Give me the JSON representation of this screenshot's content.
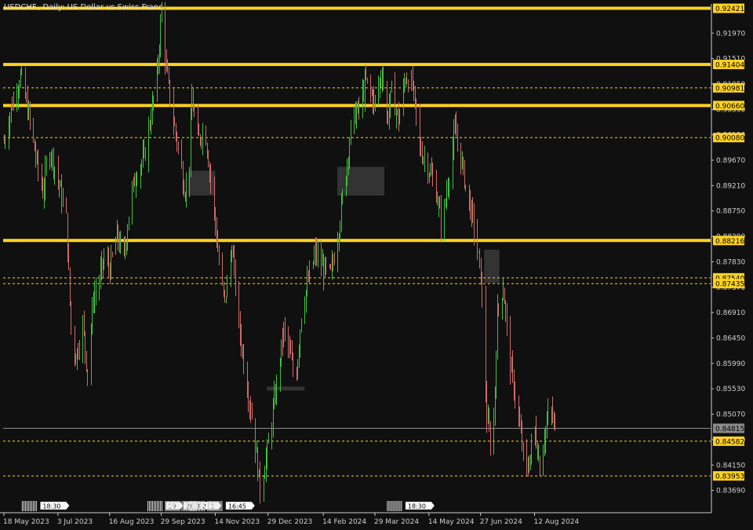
{
  "chart_data": {
    "type": "candlestick",
    "title": "USDCHF., Daily:  US Dollar vs Swiss Franc",
    "symbol": "USDCHF.",
    "timeframe": "Daily",
    "y_range": [
      0.834,
      0.925
    ],
    "y_ticks": [
      "0.91970",
      "0.91510",
      "0.91050",
      "0.90590",
      "0.90130",
      "0.89670",
      "0.89210",
      "0.88750",
      "0.88290",
      "0.87830",
      "0.87370",
      "0.86910",
      "0.86450",
      "0.85990",
      "0.85530",
      "0.85070",
      "0.84610",
      "0.84150",
      "0.83690"
    ],
    "x_labels": [
      "18 May 2023",
      "3 Jul 2023",
      "16 Aug 2023",
      "29 Sep 2023",
      "14 Nov 2023",
      "29 Dec 2023",
      "14 Feb 2024",
      "29 Mar 2024",
      "14 May 2024",
      "27 Jun 2024",
      "12 Aug 2024"
    ],
    "horizontal_levels": [
      {
        "price": "0.92421",
        "style": "solid",
        "color": "#ffd21f"
      },
      {
        "price": "0.91404",
        "style": "solid",
        "color": "#ffd21f"
      },
      {
        "price": "0.90981",
        "style": "dashed",
        "color": "#ffd21f"
      },
      {
        "price": "0.90660",
        "style": "solid",
        "color": "#ffd21f"
      },
      {
        "price": "0.90080",
        "style": "dashed",
        "color": "#ffd21f"
      },
      {
        "price": "0.88216",
        "style": "solid",
        "color": "#ffd21f"
      },
      {
        "price": "0.87540",
        "style": "dashed",
        "color": "#ffd21f"
      },
      {
        "price": "0.87435",
        "style": "dashed",
        "color": "#ffd21f"
      },
      {
        "price": "0.84582",
        "style": "dashed",
        "color": "#ffd21f"
      },
      {
        "price": "0.83953",
        "style": "dashed",
        "color": "#ffd21f"
      }
    ],
    "current_price": "0.84815",
    "path": [
      [
        "18 May 2023",
        0.9
      ],
      [
        "2023-05-25",
        0.907
      ],
      [
        "2023-06-01",
        0.912
      ],
      [
        "2023-06-08",
        0.905
      ],
      [
        "2023-06-15",
        0.896
      ],
      [
        "2023-06-20",
        0.891
      ],
      [
        "2023-06-26",
        0.899
      ],
      [
        "3 Jul 2023",
        0.893
      ],
      [
        "2023-07-10",
        0.886
      ],
      [
        "2023-07-14",
        0.866
      ],
      [
        "2023-07-18",
        0.861
      ],
      [
        "2023-07-24",
        0.867
      ],
      [
        "2023-07-28",
        0.858
      ],
      [
        "2023-08-02",
        0.872
      ],
      [
        "2023-08-07",
        0.875
      ],
      [
        "2023-08-11",
        0.879
      ],
      [
        "16 Aug 2023",
        0.877
      ],
      [
        "2023-08-22",
        0.883
      ],
      [
        "2023-08-28",
        0.879
      ],
      [
        "2023-09-02",
        0.889
      ],
      [
        "2023-09-08",
        0.895
      ],
      [
        "2023-09-14",
        0.897
      ],
      [
        "2023-09-20",
        0.905
      ],
      [
        "2023-09-25",
        0.912
      ],
      [
        "2023-09-29",
        0.924
      ],
      [
        "2023-10-03",
        0.913
      ],
      [
        "2023-10-08",
        0.905
      ],
      [
        "2023-10-13",
        0.899
      ],
      [
        "2023-10-18",
        0.892
      ],
      [
        "2023-10-22",
        0.891
      ],
      [
        "2023-10-25",
        0.908
      ],
      [
        "2023-10-30",
        0.9
      ],
      [
        "2023-11-05",
        0.903
      ],
      [
        "14 Nov 2023",
        0.885
      ],
      [
        "2023-11-18",
        0.876
      ],
      [
        "2023-11-22",
        0.871
      ],
      [
        "2023-11-28",
        0.881
      ],
      [
        "2023-12-04",
        0.867
      ],
      [
        "2023-12-10",
        0.857
      ],
      [
        "2023-12-16",
        0.849
      ],
      [
        "2023-12-22",
        0.837
      ],
      [
        "29 Dec 2023",
        0.845
      ],
      [
        "2024-01-05",
        0.856
      ],
      [
        "2024-01-11",
        0.866
      ],
      [
        "2024-01-17",
        0.861
      ],
      [
        "2024-01-21",
        0.856
      ],
      [
        "2024-01-26",
        0.869
      ],
      [
        "2024-02-01",
        0.875
      ],
      [
        "2024-02-07",
        0.88
      ],
      [
        "14 Feb 2024",
        0.877
      ],
      [
        "2024-02-20",
        0.876
      ],
      [
        "2024-02-26",
        0.883
      ],
      [
        "2024-03-03",
        0.893
      ],
      [
        "2024-03-09",
        0.904
      ],
      [
        "2024-03-15",
        0.906
      ],
      [
        "2024-03-21",
        0.911
      ],
      [
        "29 Mar 2024",
        0.907
      ],
      [
        "2024-04-04",
        0.913
      ],
      [
        "2024-04-08",
        0.904
      ],
      [
        "2024-04-12",
        0.909
      ],
      [
        "2024-04-18",
        0.904
      ],
      [
        "2024-04-24",
        0.912
      ],
      [
        "2024-04-30",
        0.91
      ],
      [
        "2024-05-06",
        0.899
      ],
      [
        "14 May 2024",
        0.895
      ],
      [
        "2024-05-20",
        0.891
      ],
      [
        "2024-05-25",
        0.884
      ],
      [
        "2024-05-30",
        0.893
      ],
      [
        "2024-06-05",
        0.902
      ],
      [
        "2024-06-10",
        0.897
      ],
      [
        "2024-06-15",
        0.891
      ],
      [
        "2024-06-20",
        0.886
      ],
      [
        "27 Jun 2024",
        0.876
      ],
      [
        "2024-07-02",
        0.85
      ],
      [
        "2024-07-07",
        0.843
      ],
      [
        "2024-07-11",
        0.869
      ],
      [
        "2024-07-16",
        0.874
      ],
      [
        "2024-07-21",
        0.861
      ],
      [
        "2024-07-27",
        0.853
      ],
      [
        "2024-08-01",
        0.845
      ],
      [
        "2024-08-05",
        0.84
      ],
      [
        "12 Aug 2024",
        0.848
      ],
      [
        "2024-08-16",
        0.841
      ],
      [
        "2024-08-20",
        0.847
      ],
      [
        "2024-08-25",
        0.852
      ],
      [
        "2024-08-29",
        0.848
      ]
    ],
    "zones": [
      {
        "from": "2023-10-22",
        "to": "2023-11-14",
        "price_top": 0.8948,
        "price_bottom": 0.8903
      },
      {
        "from": "2024-02-26",
        "to": "2024-04-06",
        "price_top": 0.8955,
        "price_bottom": 0.8903
      },
      {
        "from": "2024-06-30",
        "to": "2024-07-13",
        "price_top": 0.8805,
        "price_bottom": 0.8745
      },
      {
        "from": "2023-12-28",
        "to": "2024-01-29",
        "price_top": 0.8557,
        "price_bottom": 0.855
      }
    ],
    "session_markers": [
      {
        "date": "2023-06-20",
        "label": "18:30"
      },
      {
        "date": "2023-10-05",
        "label": "19"
      },
      {
        "date": "2023-10-20",
        "label": "20:3"
      },
      {
        "date": "2023-11-03",
        "label": "2"
      },
      {
        "date": "2023-11-10",
        "label": "1"
      },
      {
        "date": "2023-11-25",
        "label": "16:45"
      },
      {
        "date": "2024-04-26",
        "label": "18:30"
      }
    ],
    "colors": {
      "background": "#101010",
      "bull": "#3ec23e",
      "bear": "#d06a6a",
      "level": "#ffd21f",
      "axis_text": "#cfcfcf",
      "current_line": "#8c8c8c",
      "zone": "#3a3a3a"
    },
    "grid": false
  }
}
